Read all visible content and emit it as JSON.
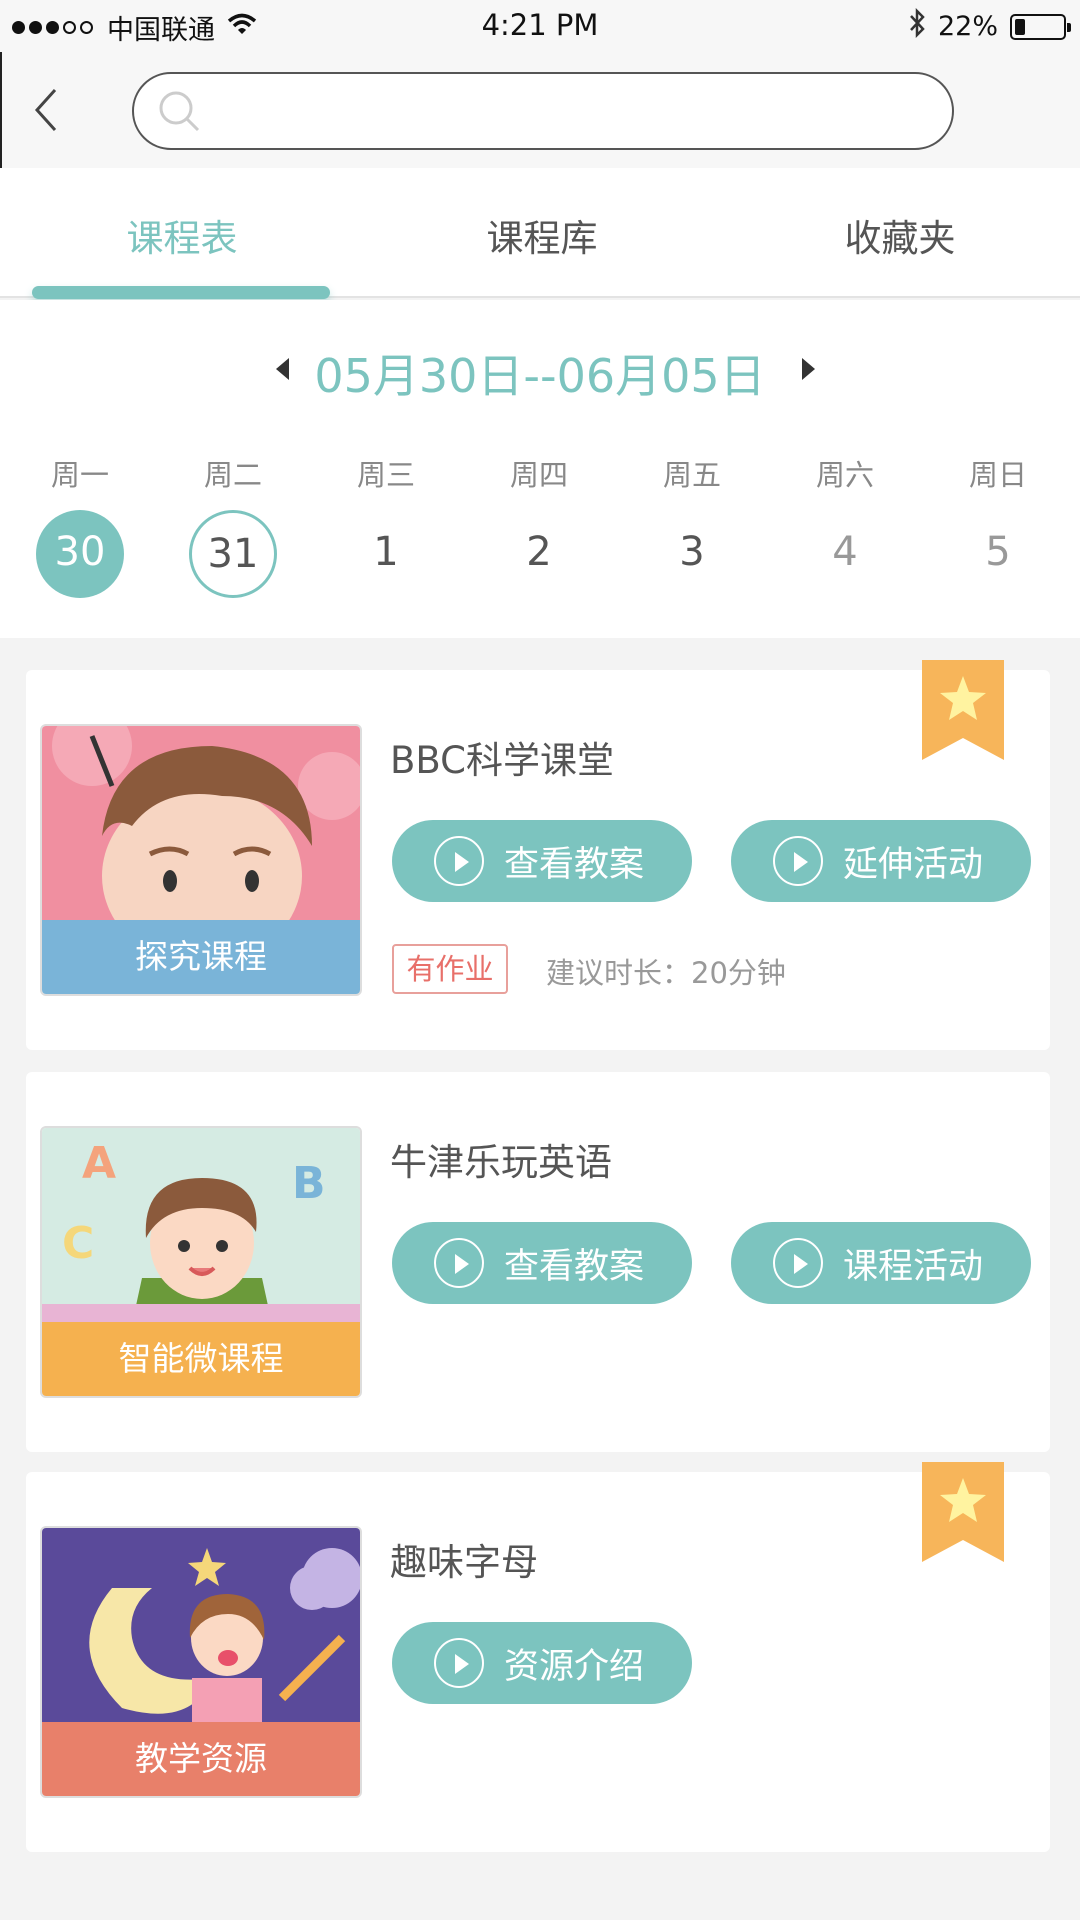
{
  "status_bar": {
    "carrier": "中国联通",
    "time": "4:21 PM",
    "battery": "22%",
    "battery_level": 0.22
  },
  "search": {
    "placeholder": ""
  },
  "tabs": [
    {
      "label": "课程表",
      "active": true
    },
    {
      "label": "课程库",
      "active": false
    },
    {
      "label": "收藏夹",
      "active": false
    }
  ],
  "week": {
    "range": "05月30日--06月05日",
    "days": [
      {
        "weekday": "周一",
        "date": "30",
        "state": "selected"
      },
      {
        "weekday": "周二",
        "date": "31",
        "state": "today"
      },
      {
        "weekday": "周三",
        "date": "1",
        "state": "normal"
      },
      {
        "weekday": "周四",
        "date": "2",
        "state": "normal"
      },
      {
        "weekday": "周五",
        "date": "3",
        "state": "normal"
      },
      {
        "weekday": "周六",
        "date": "4",
        "state": "muted"
      },
      {
        "weekday": "周日",
        "date": "5",
        "state": "muted"
      }
    ]
  },
  "courses": [
    {
      "title": "BBC科学课堂",
      "category": "探究课程",
      "category_color": "#7ab4d8",
      "buttons": [
        "查看教案",
        "延伸活动"
      ],
      "homework": "有作业",
      "duration": "建议时长：20分钟",
      "bookmarked": true
    },
    {
      "title": "牛津乐玩英语",
      "category": "智能微课程",
      "category_color": "#f5b14f",
      "buttons": [
        "查看教案",
        "课程活动"
      ],
      "bookmarked": false
    },
    {
      "title": "趣味字母",
      "category": "教学资源",
      "category_color": "#e8806a",
      "buttons": [
        "资源介绍"
      ],
      "bookmarked": true
    }
  ],
  "colors": {
    "accent": "#7cc4bf",
    "bookmark": "#f7b55a",
    "star": "#fff3a0"
  }
}
